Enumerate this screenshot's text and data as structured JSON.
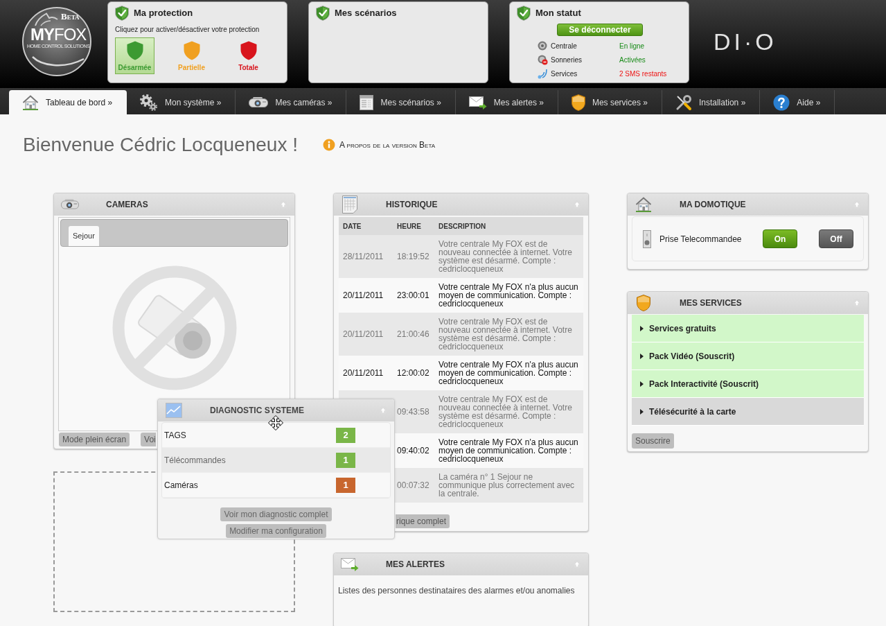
{
  "header": {
    "logo": {
      "badge": "Beta",
      "name": "**MY**FOX",
      "tagline": "HOME CONTROL SOLUTIONS"
    },
    "protection": {
      "title": "Ma protection",
      "hint": "Cliquez pour activer/désactiver votre protection",
      "modes": [
        {
          "label": "Désarmée",
          "selected": true,
          "color": "#3c9a32"
        },
        {
          "label": "Partielle",
          "selected": false,
          "color": "#f0a020"
        },
        {
          "label": "Totale",
          "selected": false,
          "color": "#d8141c"
        }
      ]
    },
    "scenarios": {
      "title": "Mes scénarios"
    },
    "status": {
      "title": "Mon statut",
      "button": "Se déconnecter",
      "rows": [
        {
          "label": "Centrale",
          "value": "En ligne",
          "color": "#178a17"
        },
        {
          "label": "Sonneries",
          "value": "Activées",
          "color": "#178a17"
        },
        {
          "label": "Services",
          "value": "2 SMS restants",
          "color": "#ee1111"
        }
      ]
    },
    "brand": "DI·O"
  },
  "nav": [
    {
      "label": "Tableau de bord »",
      "selected": true
    },
    {
      "label": "Mon système »",
      "selected": false
    },
    {
      "label": "Mes caméras »",
      "selected": false
    },
    {
      "label": "Mes scénarios »",
      "selected": false
    },
    {
      "label": "Mes alertes »",
      "selected": false
    },
    {
      "label": "Mes services »",
      "selected": false
    },
    {
      "label": "Installation »",
      "selected": false
    },
    {
      "label": "Aide »",
      "selected": false
    }
  ],
  "welcome": {
    "title": "Bienvenue Cédric Locqueneux !",
    "link": "A propos de la version Beta"
  },
  "cameras": {
    "title": "CAMERAS",
    "tabs": [
      {
        "label": "Sejour",
        "selected": true
      }
    ],
    "buttons": [
      "Mode plein écran",
      "Voi"
    ]
  },
  "history": {
    "title": "HISTORIQUE",
    "columns": [
      "DATE",
      "HEURE",
      "DESCRIPTION"
    ],
    "rows": [
      {
        "date": "28/11/2011",
        "time": "18:19:52",
        "description": "Votre centrale My FOX est de nouveau connectée à internet. Votre système est désarmé. Compte : cedriclocqueneux"
      },
      {
        "date": "20/11/2011",
        "time": "23:00:01",
        "description": "Votre centrale My FOX n'a plus aucun moyen de communication. Compte : cedriclocqueneux"
      },
      {
        "date": "20/11/2011",
        "time": "21:00:46",
        "description": "Votre centrale My FOX est de nouveau connectée à internet. Votre système est désarmé. Compte : cedriclocqueneux"
      },
      {
        "date": "20/11/2011",
        "time": "12:00:02",
        "description": "Votre centrale My FOX n'a plus aucun moyen de communication. Compte : cedriclocqueneux"
      },
      {
        "time": "09:43:58",
        "description": "Votre centrale My FOX est de nouveau connectée à internet. Votre système est désarmé. Compte : cedriclocqueneux"
      },
      {
        "time": "09:40:02",
        "description": "Votre centrale My FOX n'a plus aucun moyen de communication. Compte : cedriclocqueneux"
      },
      {
        "time": "00:07:32",
        "description": "La caméra n° 1 Sejour ne communique plus correctement avec la centrale."
      }
    ],
    "button": "rique complet"
  },
  "alerts": {
    "title": "MES ALERTES",
    "text": "Listes des personnes destinataires des alarmes et/ou anomalies"
  },
  "home_automation": {
    "title": "MA DOMOTIQUE",
    "devices": [
      {
        "name": "Prise Telecommandee",
        "buttons": [
          {
            "label": "On",
            "kind": "on"
          },
          {
            "label": "Off",
            "kind": "off"
          }
        ]
      }
    ]
  },
  "services": {
    "title": "MES SERVICES",
    "items": [
      {
        "label": "Services gratuits",
        "active": true
      },
      {
        "label": "Pack Vidéo (Souscrit)",
        "active": true
      },
      {
        "label": "Pack Interactivité (Souscrit)",
        "active": true
      },
      {
        "label": "Télésécurité à la carte",
        "active": false
      }
    ],
    "button": "Souscrire"
  },
  "diagnostic": {
    "title": "DIAGNOSTIC SYSTEME",
    "rows": [
      {
        "label": "TAGS",
        "count": "2",
        "color": "#7ab648",
        "highlighted": false
      },
      {
        "label": "Télécommandes",
        "count": "1",
        "color": "#7ab648",
        "highlighted": true
      },
      {
        "label": "Caméras",
        "count": "1",
        "color": "#c8662e",
        "highlighted": false
      }
    ],
    "buttons": [
      "Voir mon diagnostic complet",
      "Modifier ma configuration"
    ]
  }
}
